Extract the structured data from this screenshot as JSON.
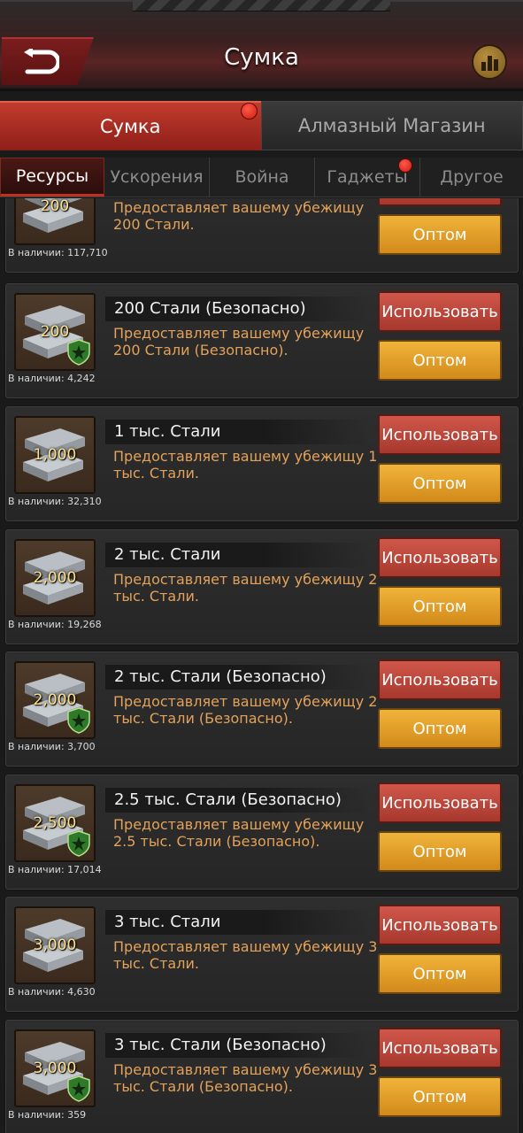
{
  "header": {
    "title": "Сумка"
  },
  "main_tabs": [
    {
      "label": "Сумка"
    },
    {
      "label": "Алмазный Магазин"
    }
  ],
  "sub_tabs": [
    {
      "label": "Ресурсы"
    },
    {
      "label": "Ускорения"
    },
    {
      "label": "Война"
    },
    {
      "label": "Гаджеты"
    },
    {
      "label": "Другое"
    }
  ],
  "buttons": {
    "use": "Использовать",
    "bulk": "Оптом"
  },
  "items": [
    {
      "qty": "200",
      "name": "",
      "desc": "Предоставляет вашему убежищу 200 Стали.",
      "stock": "В наличии: 117,710",
      "safe": false
    },
    {
      "qty": "200",
      "name": "200 Стали (Безопасно)",
      "desc": "Предоставляет вашему убежищу 200 Стали (Безопасно).",
      "stock": "В наличии: 4,242",
      "safe": true
    },
    {
      "qty": "1,000",
      "name": "1 тыс. Стали",
      "desc": "Предоставляет вашему убежищу 1 тыс. Стали.",
      "stock": "В наличии: 32,310",
      "safe": false
    },
    {
      "qty": "2,000",
      "name": "2 тыс. Стали",
      "desc": "Предоставляет вашему убежищу 2 тыс. Стали.",
      "stock": "В наличии: 19,268",
      "safe": false
    },
    {
      "qty": "2,000",
      "name": "2 тыс. Стали (Безопасно)",
      "desc": "Предоставляет вашему убежищу 2 тыс. Стали (Безопасно).",
      "stock": "В наличии: 3,700",
      "safe": true
    },
    {
      "qty": "2,500",
      "name": "2.5 тыс. Стали (Безопасно)",
      "desc": "Предоставляет вашему убежищу 2.5 тыс. Стали (Безопасно).",
      "stock": "В наличии: 17,014",
      "safe": true
    },
    {
      "qty": "3,000",
      "name": "3 тыс. Стали",
      "desc": "Предоставляет вашему убежищу 3 тыс. Стали.",
      "stock": "В наличии: 4,630",
      "safe": false
    },
    {
      "qty": "3,000",
      "name": "3 тыс. Стали (Безопасно)",
      "desc": "Предоставляет вашему убежищу 3 тыс. Стали (Безопасно).",
      "stock": "В наличии: 359",
      "safe": true
    }
  ],
  "icons": {
    "back": "back-arrow-icon",
    "stats": "bar-chart-icon",
    "steel": "steel-ingot-icon",
    "shield": "shield-star-icon"
  }
}
